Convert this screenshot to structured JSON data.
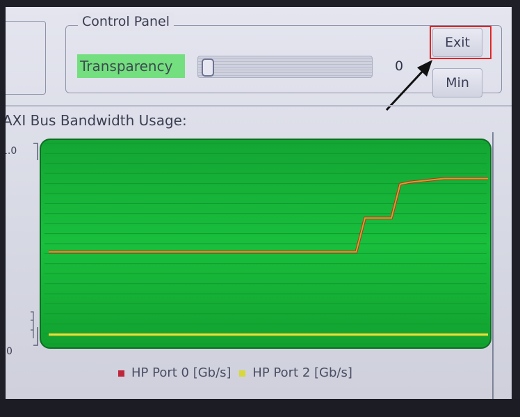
{
  "control_panel": {
    "title": "Control Panel",
    "transparency_label": "Transparency",
    "transparency_value": "0",
    "transparency_level": 0,
    "exit_label": "Exit",
    "min_label": "Min"
  },
  "colors": {
    "plot_bg": "#15b43a",
    "label_highlight": "#74df7e",
    "annotation": "#e02525",
    "series_port0": "#c0263a",
    "series_port2": "#d8d83a"
  },
  "chart_data": {
    "type": "line",
    "title": "AXI Bus Bandwidth Usage:",
    "y_tick_labels": [
      "1.0",
      "0"
    ],
    "ylim": [
      0,
      1.0
    ],
    "xlim": [
      0,
      100
    ],
    "grid": true,
    "legend_position": "bottom",
    "series": [
      {
        "name": "HP Port 0 [Gb/s]",
        "color": "#c0263a",
        "x": [
          0,
          70,
          72,
          78,
          80,
          82,
          90,
          100
        ],
        "y": [
          0.46,
          0.46,
          0.64,
          0.64,
          0.82,
          0.83,
          0.85,
          0.85
        ]
      },
      {
        "name": "HP Port 2 [Gb/s]",
        "color": "#d8d83a",
        "x": [
          0,
          100
        ],
        "y": [
          0.02,
          0.02
        ]
      }
    ]
  }
}
